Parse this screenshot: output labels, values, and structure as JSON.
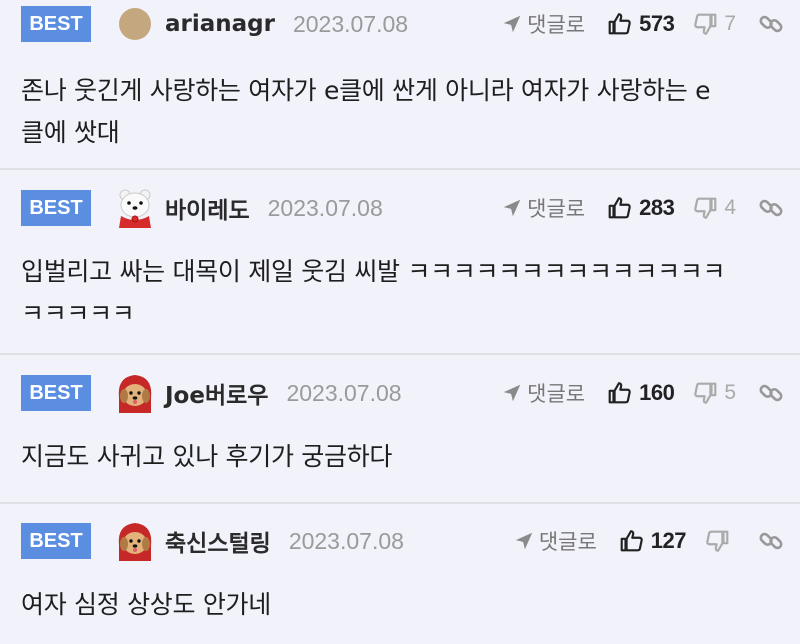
{
  "comments": [
    {
      "badge": "BEST",
      "avatar_icon": "tan-circle-avatar-icon",
      "username": "arianagr",
      "date": "2023.07.08",
      "reply_label": "댓글로",
      "likes": "573",
      "dislikes": "7",
      "text_lines": [
        "존나 웃긴게 사랑하는 여자가 e클에 싼게 아니라 여자가 사랑하는 e",
        "클에 쌋대"
      ]
    },
    {
      "badge": "BEST",
      "avatar_icon": "polar-bear-avatar-icon",
      "username": "바이레도",
      "date": "2023.07.08",
      "reply_label": "댓글로",
      "likes": "283",
      "dislikes": "4",
      "text_lines": [
        "입벌리고 싸는 대목이 제일 웃김 씨발 ㅋㅋㅋㅋㅋㅋㅋㅋㅋㅋㅋㅋㅋㅋ",
        "ㅋㅋㅋㅋㅋ"
      ]
    },
    {
      "badge": "BEST",
      "avatar_icon": "puppy-red-hood-avatar-icon",
      "username": "Joe버로우",
      "date": "2023.07.08",
      "reply_label": "댓글로",
      "likes": "160",
      "dislikes": "5",
      "text_lines": [
        "지금도 사귀고 있나 후기가 궁금하다"
      ]
    },
    {
      "badge": "BEST",
      "avatar_icon": "puppy-red-hood-avatar-icon",
      "username": "축신스털링",
      "date": "2023.07.08",
      "reply_label": "댓글로",
      "likes": "127",
      "dislikes": "",
      "text_lines": [
        "여자 심정 상상도 안가네"
      ]
    }
  ],
  "colors": {
    "best_badge": "#5b8de0",
    "background": "#f1f2fa",
    "divider": "#dfe0e6"
  }
}
